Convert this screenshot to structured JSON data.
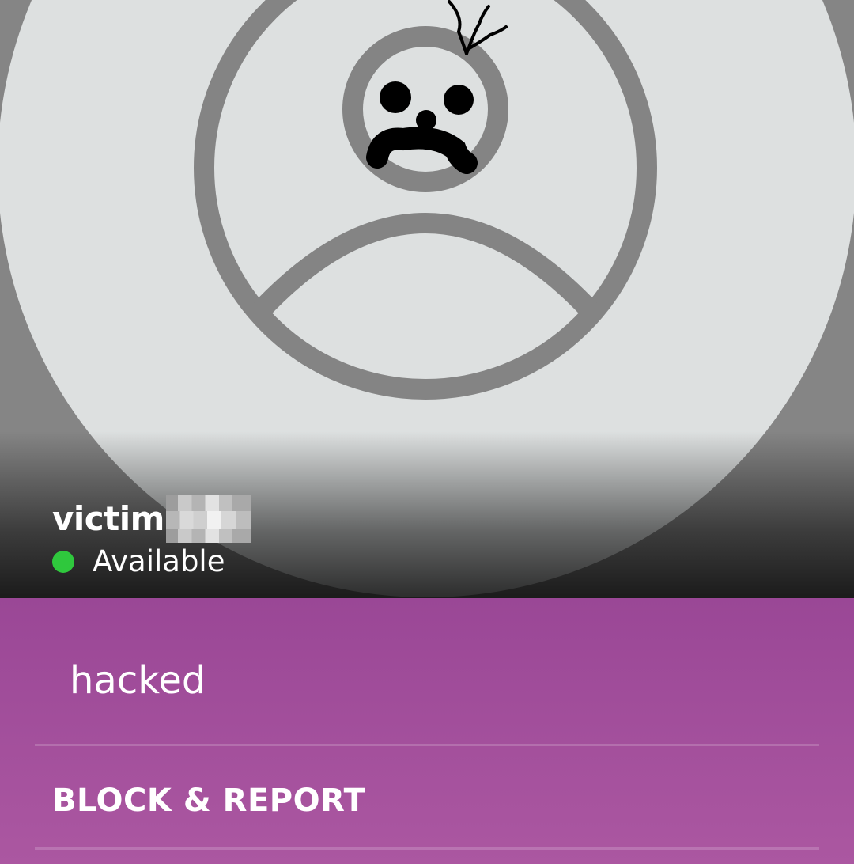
{
  "profile": {
    "name": "victim",
    "status": "Available",
    "status_color": "#2fc83d",
    "avatar_icon": "default-avatar-icon"
  },
  "about": {
    "mood": "hacked"
  },
  "actions": {
    "block_report_label": "BLOCK & REPORT"
  },
  "colors": {
    "panel_top": "#9a4796",
    "panel_bottom": "#ab57a1",
    "hero_background": "#858585",
    "avatar_fill": "#dde0e0",
    "avatar_outline": "#848484"
  }
}
